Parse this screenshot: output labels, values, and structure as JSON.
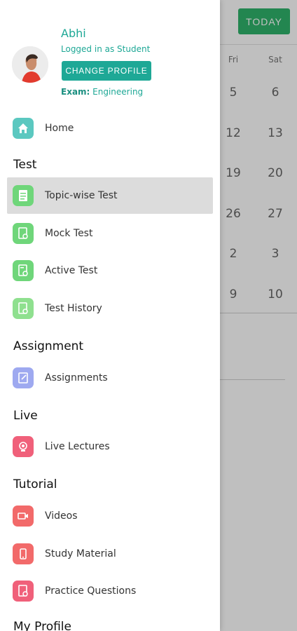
{
  "background": {
    "today_button": "TODAY",
    "day_headers": [
      "Fri",
      "Sat"
    ],
    "rows": [
      [
        "5",
        "6"
      ],
      [
        "12",
        "13"
      ],
      [
        "19",
        "20"
      ],
      [
        "26",
        "27"
      ],
      [
        "2",
        "3"
      ],
      [
        "9",
        "10"
      ]
    ]
  },
  "profile": {
    "name": "Abhi",
    "role": "Logged in as Student",
    "change_button": "CHANGE PROFILE",
    "exam_label": "Exam:",
    "exam_value": "Engineering"
  },
  "menu": {
    "home": "Home",
    "sections": {
      "test": "Test",
      "assignment": "Assignment",
      "live": "Live",
      "tutorial": "Tutorial",
      "my_profile": "My Profile"
    },
    "items": {
      "topic_wise_test": "Topic-wise Test",
      "mock_test": "Mock Test",
      "active_test": "Active Test",
      "test_history": "Test History",
      "assignments": "Assignments",
      "live_lectures": "Live Lectures",
      "videos": "Videos",
      "study_material": "Study Material",
      "practice_questions": "Practice Questions"
    }
  },
  "colors": {
    "accent": "#1ea896",
    "today_green": "#2fb36b",
    "test_icon": "#6fd67a",
    "home_icon": "#5bc8c0",
    "assignment_icon": "#9ea9f0",
    "live_icon": "#f0607a",
    "video_icon": "#f26a6a"
  }
}
